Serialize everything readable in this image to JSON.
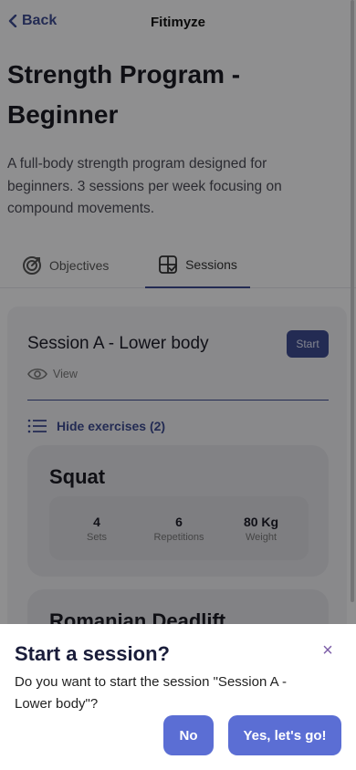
{
  "header": {
    "back_label": "Back",
    "app_title": "Fitimyze"
  },
  "program": {
    "title": "Strength Program - Beginner",
    "description": "A full-body strength program designed for beginners. 3 sessions per week focusing on compound movements."
  },
  "tabs": [
    {
      "label": "Objectives",
      "icon": "target-icon",
      "active": false
    },
    {
      "label": "Sessions",
      "icon": "sessions-icon",
      "active": true
    }
  ],
  "session": {
    "title": "Session A - Lower body",
    "start_label": "Start",
    "view_label": "View",
    "hide_exercises_label": "Hide exercises (2)",
    "exercises": [
      {
        "name": "Squat",
        "stats": [
          {
            "value": "4",
            "label": "Sets"
          },
          {
            "value": "6",
            "label": "Repetitions"
          },
          {
            "value": "80 Kg",
            "label": "Weight"
          }
        ]
      },
      {
        "name": "Romanian Deadlift"
      }
    ]
  },
  "modal": {
    "title": "Start a session?",
    "close_symbol": "×",
    "message": "Do you want to start the session \"Session A - Lower body\"?",
    "no_label": "No",
    "yes_label": "Yes, let's go!"
  },
  "colors": {
    "accent": "#3d4a8f",
    "button": "#5b6ed4",
    "close": "#7d5ea8"
  }
}
